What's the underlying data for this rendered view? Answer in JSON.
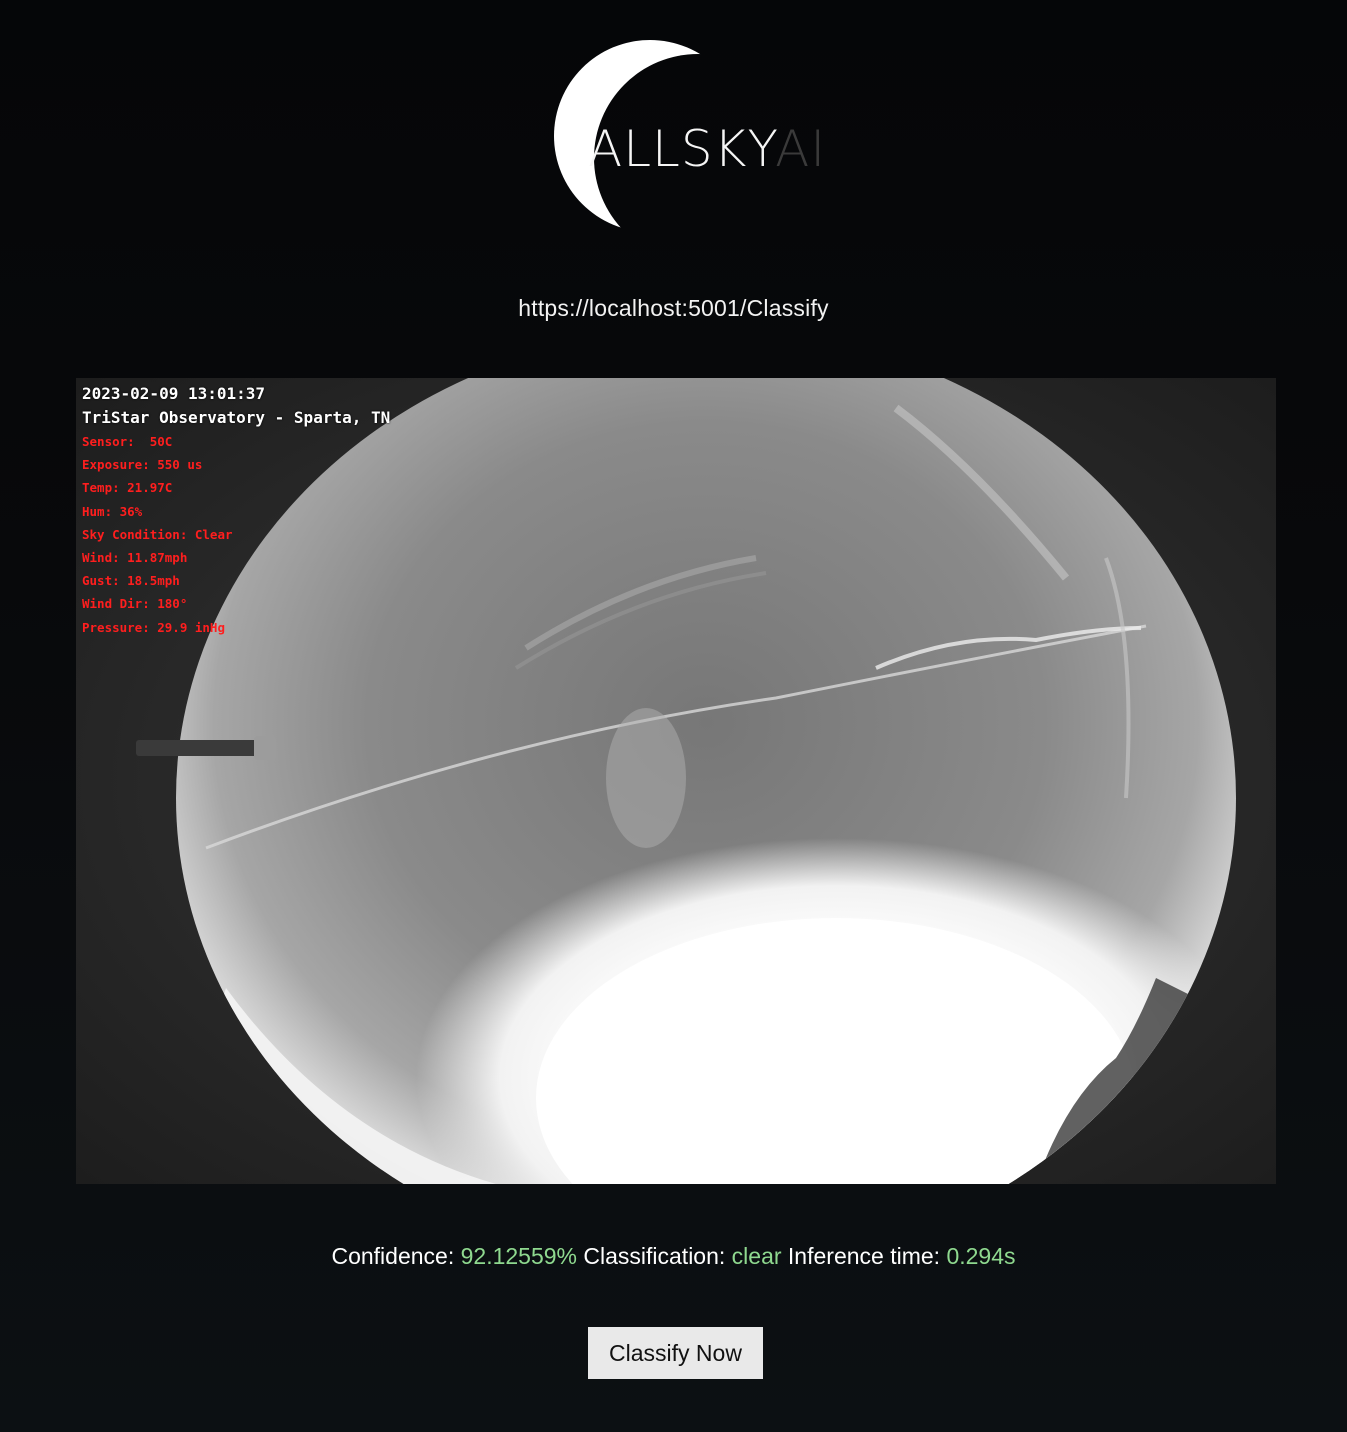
{
  "logo": {
    "text_main": "ALLSKY",
    "text_accent": "AI",
    "colors": {
      "main": "#f5f5f5",
      "accent": "#3a3a3a",
      "crescent": "#ffffff"
    }
  },
  "url_text": "https://localhost:5001/Classify",
  "camera_image": {
    "overlay": {
      "timestamp": "2023-02-09 13:01:37",
      "location": "TriStar Observatory - Sparta, TN",
      "sensor": "Sensor:  50C",
      "exposure": "Exposure: 550 us",
      "temp": "Temp: 21.97C",
      "hum": "Hum: 36%",
      "sky_condition": "Sky Condition: Clear",
      "wind": "Wind: 11.87mph",
      "gust": "Gust: 18.5mph",
      "wind_dir": "Wind Dir: 180°",
      "pressure": "Pressure: 29.9 inHg"
    },
    "colors": {
      "overlay_white": "#ffffff",
      "overlay_red": "#ff1e1e"
    }
  },
  "results": {
    "confidence_label": "Confidence:",
    "confidence_value": "92.12559%",
    "classification_label": "Classification:",
    "classification_value": "clear",
    "inference_label": "Inference time:",
    "inference_value": "0.294s",
    "value_color": "#8fd98f"
  },
  "classify_button": {
    "label": "Classify Now"
  }
}
